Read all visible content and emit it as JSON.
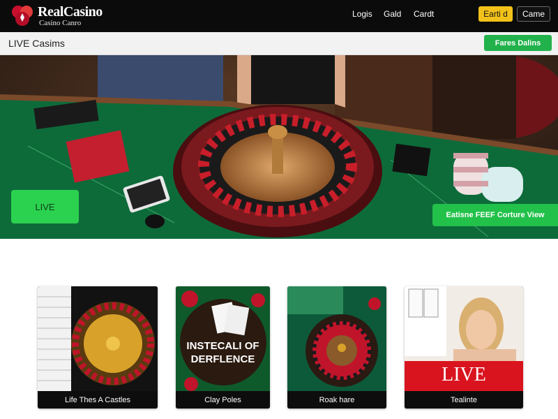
{
  "header": {
    "brand": "RealCasino",
    "brand_sub": "Casino Canro",
    "nav": [
      "Logis",
      "Gald",
      "Cardt"
    ],
    "btn_primary": "Earti d",
    "btn_secondary": "Came"
  },
  "subheader": {
    "title": "LIVE Casims",
    "action": "Fares Dalins"
  },
  "hero": {
    "live_button": "LIVE",
    "cta": "Eatisne FEEF Corture View"
  },
  "cards": [
    {
      "caption": "Life Thes A Castles"
    },
    {
      "caption": "Clay Poles",
      "overlay_line1": "INSTECALI OF",
      "overlay_line2": "DERFLENCE"
    },
    {
      "caption": "Roak hare"
    },
    {
      "caption": "Tealinte",
      "overlay": "LIVE"
    }
  ],
  "colors": {
    "brand_red": "#c8102e",
    "accent_green": "#22b24c",
    "accent_yellow": "#f2c21a",
    "felt_green": "#0d6b3a"
  }
}
